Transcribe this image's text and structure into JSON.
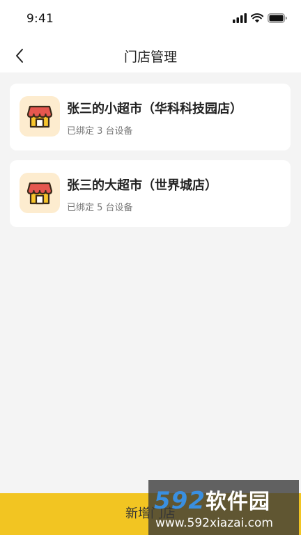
{
  "status_bar": {
    "time": "9:41"
  },
  "nav": {
    "title": "门店管理"
  },
  "stores": [
    {
      "name": "张三的小超市（华科科技园店）",
      "devices": "已绑定 3 台设备"
    },
    {
      "name": "张三的大超市（世界城店）",
      "devices": "已绑定 5 台设备"
    }
  ],
  "bottom_button": {
    "label": "新增门店"
  },
  "watermark": {
    "number": "592",
    "brand": "软件园",
    "url": "www.592xiazai.com"
  },
  "colors": {
    "accent": "#f2c522",
    "store_icon_bg": "#fdeccf",
    "awning_red": "#e5574f",
    "house_yellow": "#f7c52c"
  }
}
